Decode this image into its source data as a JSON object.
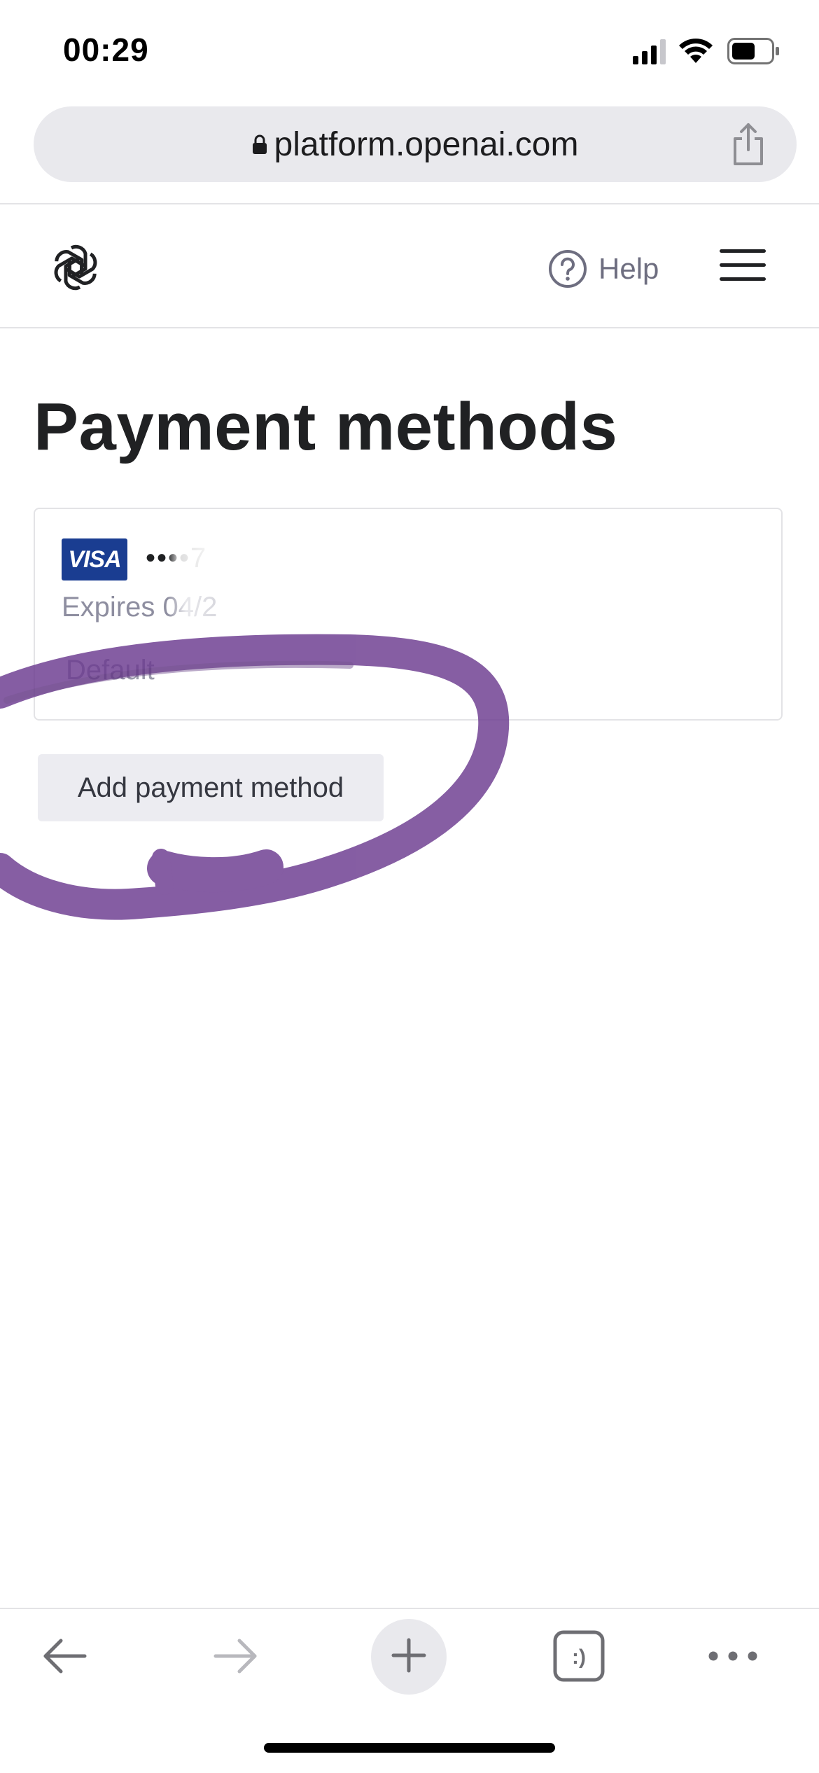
{
  "status_bar": {
    "time": "00:29",
    "icons": [
      "signal-icon",
      "wifi-icon",
      "battery-icon"
    ]
  },
  "browser": {
    "url": "platform.openai.com",
    "icons": [
      "lock-icon",
      "share-icon"
    ]
  },
  "header": {
    "logo": "openai-logo-icon",
    "help_label": "Help",
    "menu": "hamburger-menu-icon"
  },
  "main": {
    "title": "Payment methods",
    "card": {
      "brand": "VISA",
      "number_masked": "••••7",
      "expiry": "Expires 04/2",
      "default_label": "Default"
    },
    "add_button_label": "Add payment method"
  },
  "toolbar": {
    "icons": [
      "back-arrow-icon",
      "forward-arrow-icon",
      "plus-icon",
      "tabs-icon",
      "more-icon"
    ],
    "tabs_label": ":)"
  },
  "colors": {
    "visa_blue": "#1a3d91",
    "annotation_purple": "#6b3a8f",
    "url_bar_bg": "#e9e9ed",
    "button_bg": "#ececf1"
  }
}
